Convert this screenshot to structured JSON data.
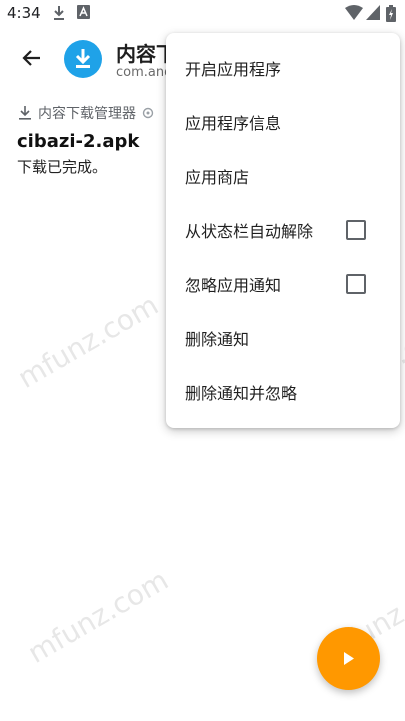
{
  "status_bar": {
    "time": "4:34",
    "left_icons": [
      "download-icon",
      "a-badge-icon"
    ],
    "right_icons": [
      "wifi-icon",
      "signal-icon",
      "battery-icon"
    ]
  },
  "app_bar": {
    "title": "内容下",
    "package": "com.and"
  },
  "notification": {
    "app_name": "内容下载管理器",
    "title": "cibazi-2.apk",
    "text": "下载已完成。"
  },
  "menu": {
    "items": [
      {
        "label": "开启应用程序"
      },
      {
        "label": "应用程序信息"
      },
      {
        "label": "应用商店"
      },
      {
        "label": "从状态栏自动解除",
        "checked": false
      },
      {
        "label": "忽略应用通知",
        "checked": false
      },
      {
        "label": "删除通知"
      },
      {
        "label": "删除通知并忽略"
      }
    ]
  },
  "watermark": "mfunz.com",
  "colors": {
    "accent": "#ff9800",
    "app_icon": "#1fa2e8"
  }
}
